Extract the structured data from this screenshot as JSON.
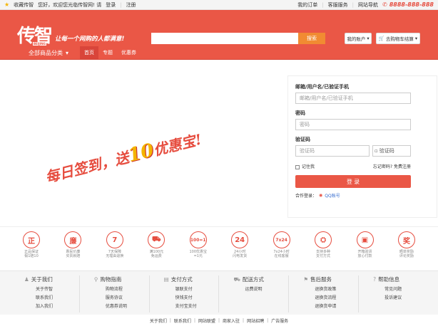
{
  "topbar": {
    "favorite": "收藏传智",
    "welcome": "您好，欢迎您光临传智网! 请",
    "login": "登录",
    "register": "注册",
    "my_orders": "我的订单",
    "customer_service": "客服服务",
    "site_nav": "网站导航",
    "phone": "8888-888-888"
  },
  "header": {
    "logo": "传智",
    "logo_sub": "BEIJING",
    "slogan": "让每一个网购的人都满意!",
    "search_placeholder": "",
    "search_button": "搜索",
    "my_account": "我的账户",
    "cart": "去购物车结算"
  },
  "nav": {
    "all_categories": "全部商品分类",
    "links": [
      "首页",
      "专题",
      "优惠券"
    ]
  },
  "promo": {
    "prefix": "每日签到，送",
    "number": "10",
    "suffix": "优惠宝!"
  },
  "login": {
    "username_label": "邮箱/用户名/已验证手机",
    "username_placeholder": "邮箱/用户名/已验证手机",
    "password_label": "密码",
    "password_placeholder": "密码",
    "captcha_label": "验证码",
    "captcha_placeholder": "验证码",
    "captcha_image": "验证码",
    "remember": "记住我",
    "forgot": "忘记密码?",
    "free_register": "免费注册",
    "button": "登 录",
    "coop_label": "合作登录：",
    "qq": "QQ账号"
  },
  "services": [
    {
      "icon": "正",
      "name": "zheng-icon",
      "l1": "正品保证",
      "l2": "假1赔10"
    },
    {
      "icon": "廉",
      "name": "lian-icon",
      "l1": "惠民价廉",
      "l2": "买贵就赔"
    },
    {
      "icon": "7",
      "name": "seven-icon",
      "l1": "7天保障",
      "l2": "无理由退换"
    },
    {
      "icon": "⛟",
      "name": "truck-icon",
      "l1": "满100元",
      "l2": "免运费"
    },
    {
      "icon": "100=1",
      "name": "exchange-icon",
      "l1": "100优惠宝",
      "l2": "=1元"
    },
    {
      "icon": "24",
      "name": "24h-icon",
      "l1": "24小时",
      "l2": "闪电发货"
    },
    {
      "icon": "7x24",
      "name": "7x24-icon",
      "l1": "7x24小时",
      "l2": "在线客服"
    },
    {
      "icon": "⛭",
      "name": "payment-icon",
      "l1": "支持多种",
      "l2": "支付方式"
    },
    {
      "icon": "▣",
      "name": "box-icon",
      "l1": "开箱验货",
      "l2": "放心付款"
    },
    {
      "icon": "奖",
      "name": "award-icon",
      "l1": "晒单奖励",
      "l2": "评论奖励"
    }
  ],
  "footer": {
    "columns": [
      {
        "icon": "about-icon",
        "title": "关于我们",
        "items": [
          "关于传智",
          "联系我们",
          "加入我们"
        ]
      },
      {
        "icon": "shopping-guide-icon",
        "title": "购物指南",
        "items": [
          "购物流程",
          "服务协议",
          "优惠券说明"
        ]
      },
      {
        "icon": "payment-method-icon",
        "title": "支付方式",
        "items": [
          "银联支付",
          "快钱支付",
          "支付宝支付"
        ]
      },
      {
        "icon": "delivery-icon",
        "title": "配送方式",
        "items": [
          "运费说明"
        ]
      },
      {
        "icon": "after-sales-icon",
        "title": "售后服务",
        "items": [
          "退换货政策",
          "退换货流程",
          "退换货申请"
        ]
      },
      {
        "icon": "help-icon",
        "title": "帮助信息",
        "items": [
          "常见问题",
          "投诉建议"
        ]
      }
    ],
    "bottom_links": [
      "关于我们",
      "联系我们",
      "网站联盟",
      "商家入驻",
      "网站招聘",
      "广告服务"
    ]
  },
  "colors": {
    "brand": "#ea5746",
    "search_button": "#f18b32",
    "accent": "#f4b400"
  }
}
